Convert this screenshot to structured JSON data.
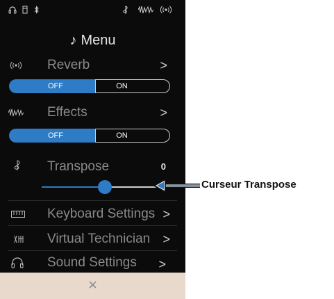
{
  "status_bar": {
    "icons": [
      "headphones-icon",
      "usb-icon",
      "bluetooth-icon",
      "transpose-icon",
      "effects-icon",
      "reverb-icon"
    ]
  },
  "menu": {
    "title": "Menu",
    "items": [
      {
        "label": "Reverb",
        "icon": "reverb-icon",
        "has_toggle": true,
        "toggle": {
          "off": "OFF",
          "on": "ON",
          "selected": "OFF"
        }
      },
      {
        "label": "Effects",
        "icon": "effects-icon",
        "has_toggle": true,
        "toggle": {
          "off": "OFF",
          "on": "ON",
          "selected": "OFF"
        }
      },
      {
        "label": "Transpose",
        "icon": "treble-clef-icon",
        "value": "0",
        "slider_level": 0.44
      },
      {
        "label": "Keyboard Settings",
        "icon": "keyboard-icon"
      },
      {
        "label": "Virtual Technician",
        "icon": "virtual-technician-icon"
      },
      {
        "label": "Sound Settings",
        "icon": "headphones-icon"
      }
    ]
  },
  "bottom_bar": {
    "close_glyph": "×"
  },
  "callout": {
    "label": "Curseur Transpose"
  },
  "colors": {
    "accent": "#2e7bc6",
    "background": "#0b0b0b",
    "bottom_bar": "#e9d9cc",
    "callout_arrow": "#2e7bc6"
  }
}
